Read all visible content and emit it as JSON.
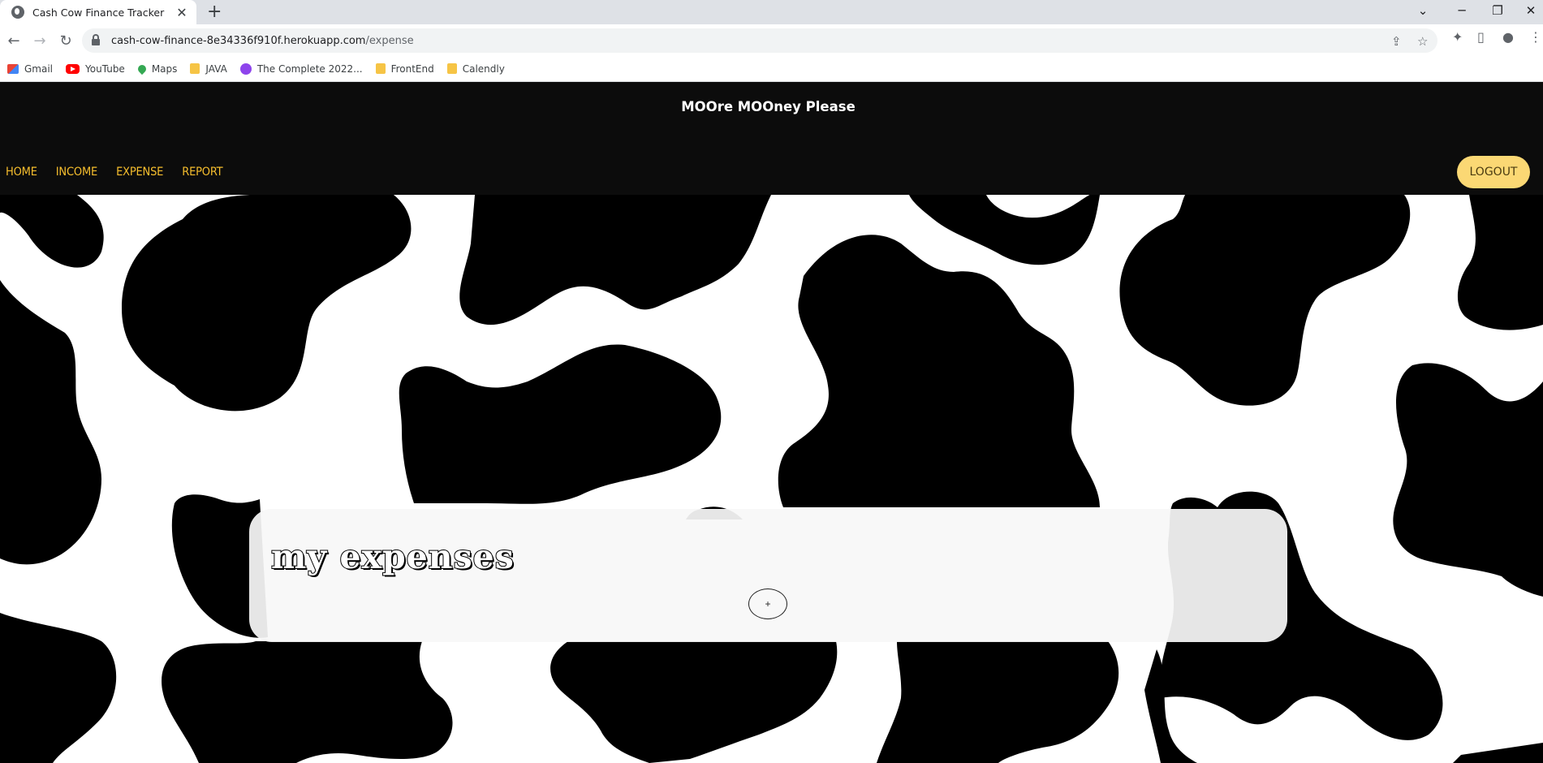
{
  "browser": {
    "tab_title": "Cash Cow Finance Tracker",
    "tab_close": "✕",
    "new_tab": "+",
    "url_host": "cash-cow-finance-8e34336f910f.herokuapp.com",
    "url_path": "/expense",
    "back": "←",
    "forward": "→",
    "reload": "↻",
    "bookmarks": [
      {
        "label": "Gmail"
      },
      {
        "label": "YouTube"
      },
      {
        "label": "Maps"
      },
      {
        "label": "JAVA"
      },
      {
        "label": "The Complete 2022..."
      },
      {
        "label": "FrontEnd"
      },
      {
        "label": "Calendly"
      }
    ]
  },
  "header": {
    "title": "MOOre MOOney Please",
    "nav": [
      "HOME",
      "INCOME",
      "EXPENSE",
      "REPORT"
    ],
    "logout_label": "LOGOUT"
  },
  "main": {
    "heading": "my expenses",
    "add_button_label": "+"
  },
  "colors": {
    "header_bg": "#0c0c0c",
    "nav_text": "#f6be2d",
    "logout_bg": "#fbd874",
    "card_bg": "#f7f7f7"
  }
}
